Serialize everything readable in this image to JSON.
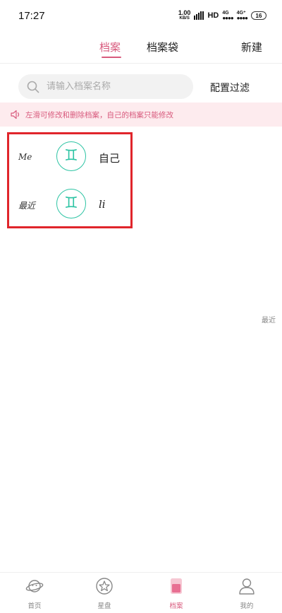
{
  "status": {
    "time": "17:27",
    "net_speed": "1.00",
    "net_unit": "KB/S",
    "hd": "HD",
    "sig1": "4G",
    "sig2": "4G⁺",
    "battery": "16"
  },
  "top_tabs": {
    "archive": "档案",
    "archive_bag": "档案袋",
    "new": "新建"
  },
  "search": {
    "placeholder": "请输入档案名称",
    "filter_label": "配置过滤"
  },
  "notice": {
    "text": "左滑可修改和删除档案，自己的档案只能修改"
  },
  "records": [
    {
      "label": "Me",
      "zodiac_icon": "gemini-icon",
      "zodiac_glyph": "♊",
      "name": "自己"
    },
    {
      "label": "最近",
      "zodiac_icon": "gemini-icon",
      "zodiac_glyph": "♊",
      "name": "li"
    }
  ],
  "side_label": "最近",
  "bottom_nav": [
    {
      "label": "首页",
      "icon": "planet-icon"
    },
    {
      "label": "星盘",
      "icon": "star-badge-icon"
    },
    {
      "label": "档案",
      "icon": "archive-icon"
    },
    {
      "label": "我的",
      "icon": "person-icon"
    }
  ],
  "colors": {
    "accent": "#d85a7d",
    "zodiac": "#2ec4a4",
    "highlight_border": "#e0252b",
    "notice_bg": "#fdebee"
  }
}
